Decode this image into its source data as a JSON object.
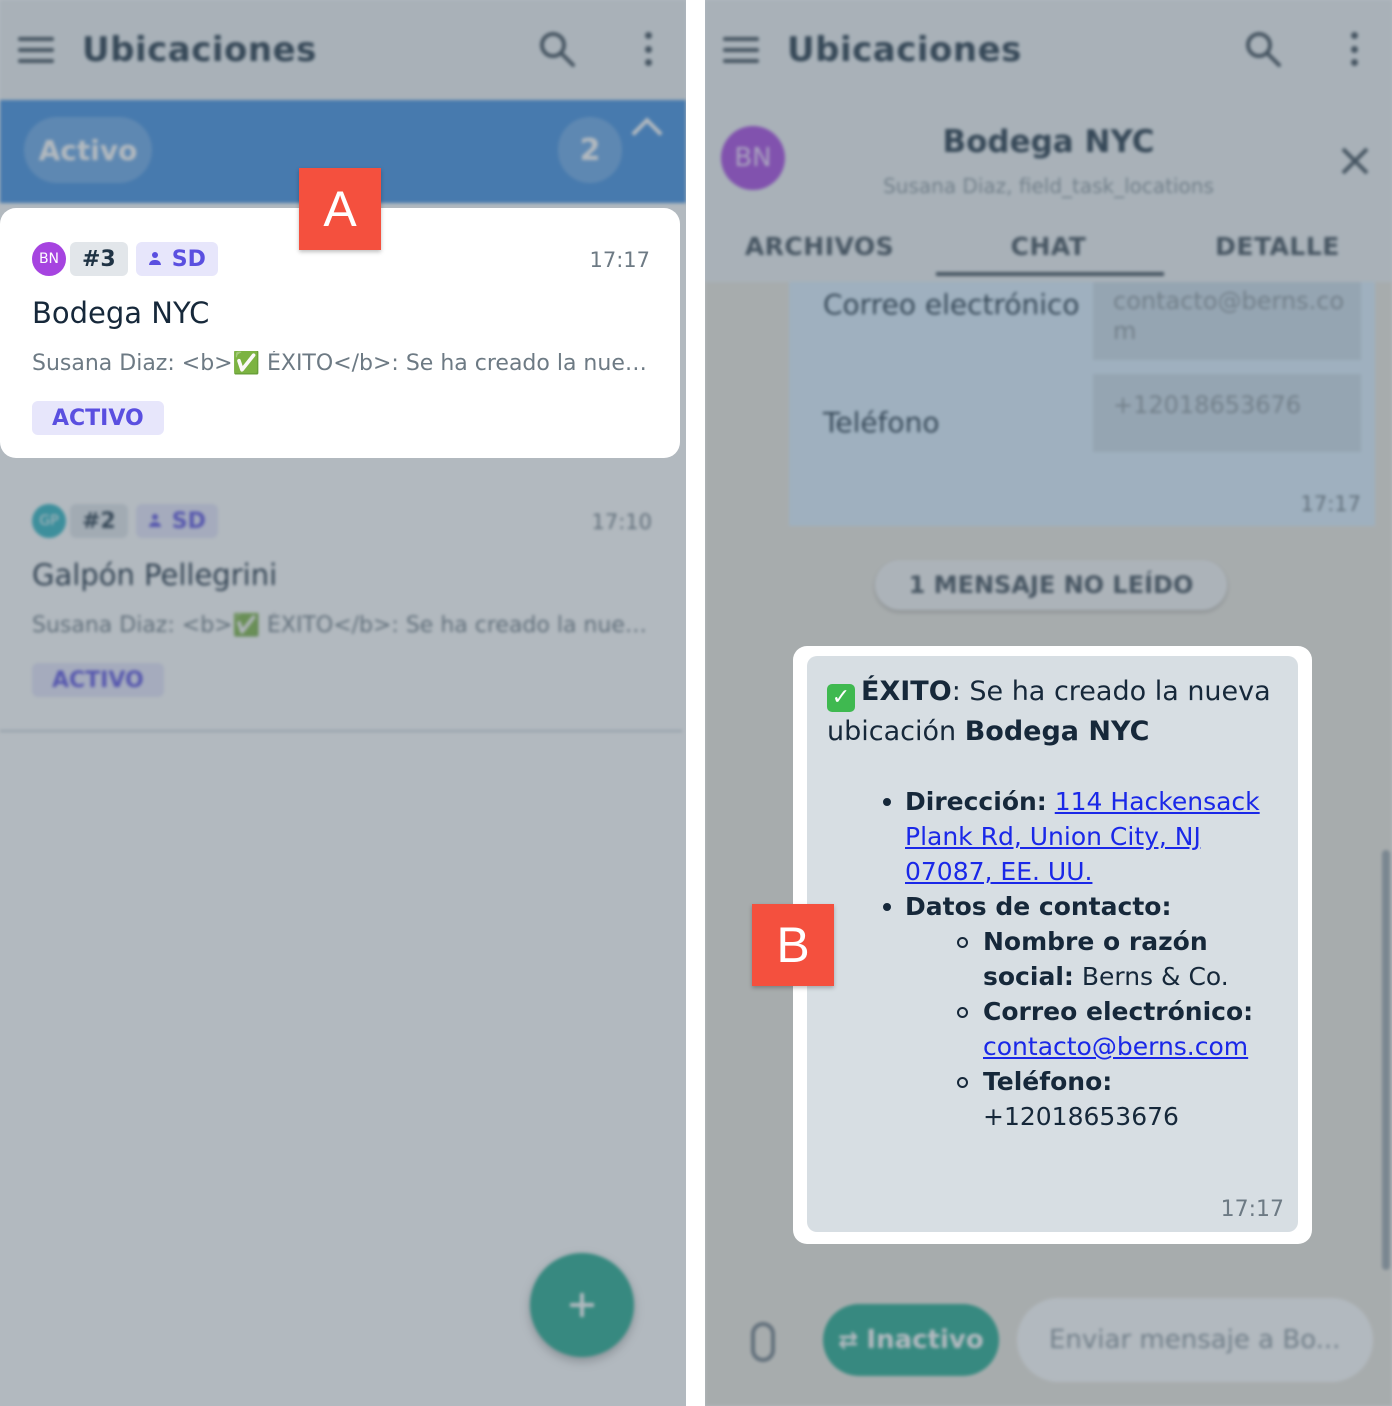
{
  "left_screen": {
    "app_title": "Ubicaciones",
    "group": {
      "label": "Activo",
      "count": "2"
    },
    "items": [
      {
        "avatar": "BN",
        "avatar_color": "#a644e0",
        "number": "#3",
        "user": "SD",
        "time": "17:17",
        "name": "Bodega NYC",
        "preview": "Susana Diaz: <b>✅ ÉXITO</b>: Se ha creado la nueva ...",
        "status": "ACTIVO"
      },
      {
        "avatar": "GP",
        "avatar_color": "#2bb3c0",
        "number": "#2",
        "user": "SD",
        "time": "17:10",
        "name": "Galpón Pellegrini",
        "preview": "Susana Diaz: <b>✅ ÉXITO</b>: Se ha creado la nueva ...",
        "status": "ACTIVO"
      }
    ],
    "fab_icon": "plus-icon"
  },
  "right_screen": {
    "app_title": "Ubicaciones",
    "chat": {
      "avatar": "BN",
      "title": "Bodega NYC",
      "subtitle": "Susana Diaz, field_task_locations",
      "tabs": [
        "ARCHIVOS",
        "CHAT",
        "DETALLE"
      ],
      "active_tab": "CHAT",
      "previous_message": {
        "rows": [
          {
            "label": "Correo electrónico",
            "value": "contacto@berns.co m"
          },
          {
            "label": "Teléfono",
            "value": "+12018653676"
          }
        ],
        "time": "17:17"
      },
      "unread_label": "1 MENSAJE NO LEÍDO",
      "message": {
        "heading_bold": "ÉXITO",
        "heading_rest": ": Se ha creado la nueva ubicación ",
        "location_bold": "Bodega NYC",
        "address_label": "Dirección:",
        "address_value": "114 Hackensack Plank Rd, Union City, NJ 07087, EE. UU.",
        "contact_label": "Datos de contacto:",
        "name_label": "Nombre o razón social:",
        "name_value": "Berns & Co.",
        "email_label": "Correo electrónico:",
        "email_value": "contacto@berns.com",
        "phone_label": "Teléfono:",
        "phone_value": "+12018653676",
        "time": "17:17"
      },
      "composer": {
        "status_button": "Inactivo",
        "placeholder": "Enviar mensaje a Bo..."
      }
    }
  },
  "markers": {
    "a": "A",
    "b": "B"
  },
  "colors": {
    "primary": "#3d8de0",
    "accent": "#1fa88c",
    "chip": "#5a4fe0",
    "marker": "#f4503e"
  }
}
